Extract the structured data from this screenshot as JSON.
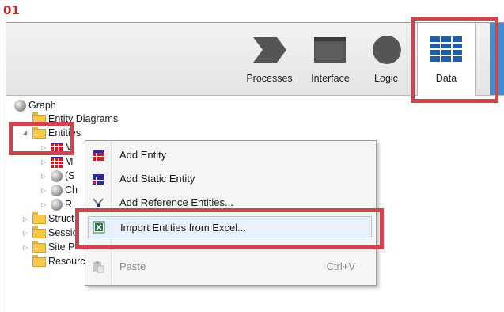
{
  "step_label": "01",
  "ribbon": {
    "buttons": [
      {
        "label": "Processes",
        "icon": "process-chevron-icon"
      },
      {
        "label": "Interface",
        "icon": "interface-window-icon"
      },
      {
        "label": "Logic",
        "icon": "logic-circle-icon"
      },
      {
        "label": "Data",
        "icon": "data-grid-icon",
        "selected": true
      }
    ]
  },
  "tree": {
    "root": "Graph",
    "entity_diagrams": "Entity Diagrams",
    "entities": "Entities",
    "children": [
      "M",
      "M",
      "(S",
      "Ch",
      "R"
    ],
    "structures": "Struct",
    "sessions": "Sessio",
    "site_properties": "Site P",
    "resources": "Resources"
  },
  "context_menu": {
    "items": [
      {
        "label": "Add Entity",
        "icon": "entity-grid-icon"
      },
      {
        "label": "Add Static Entity",
        "icon": "static-entity-icon"
      },
      {
        "label": "Add Reference Entities...",
        "icon": "reference-entities-icon"
      },
      {
        "label": "Import Entities from Excel...",
        "icon": "excel-icon",
        "highlighted": true
      },
      {
        "label": "Paste",
        "shortcut": "Ctrl+V",
        "icon": "paste-icon",
        "disabled": true
      }
    ]
  },
  "colors": {
    "highlight": "#d0454d",
    "step_label": "#c1272d",
    "ribbon_blue": "#3f8fd1",
    "entity_red": "#c0202a",
    "entity_blue": "#2a2a9a",
    "excel_green": "#1e7a3c"
  }
}
